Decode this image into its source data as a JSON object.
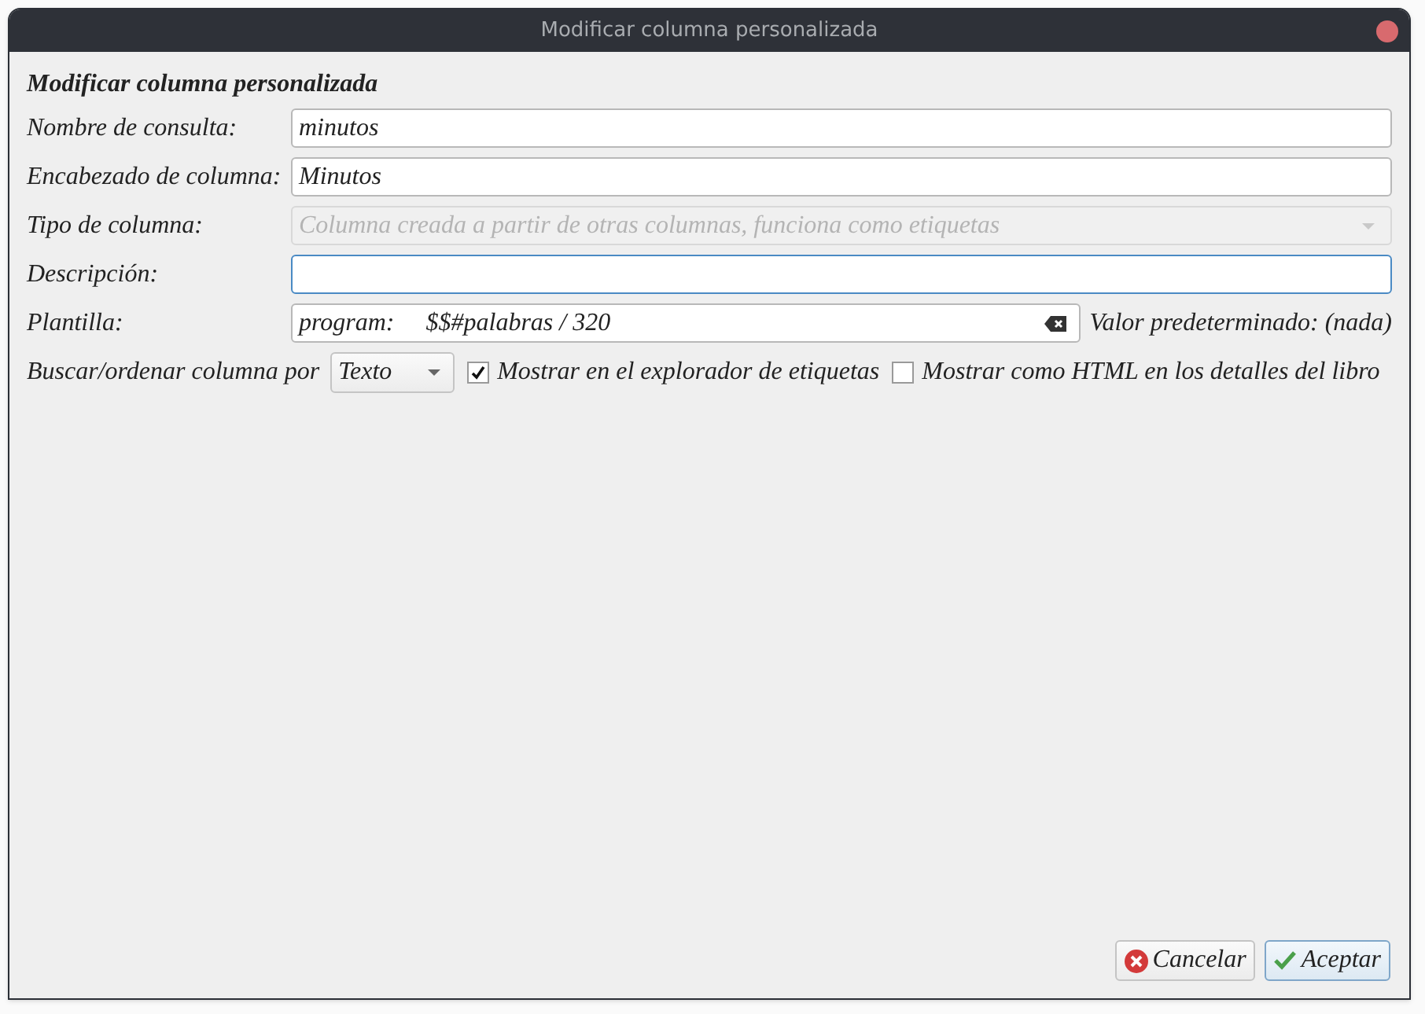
{
  "window": {
    "title": "Modificar columna personalizada"
  },
  "heading": "Modificar columna personalizada",
  "fields": [
    {
      "kind": "text",
      "label": "Nombre de consulta:",
      "value": "minutos",
      "focused": false
    },
    {
      "kind": "text",
      "label": "Encabezado de columna:",
      "value": "Minutos",
      "focused": false
    },
    {
      "kind": "combo",
      "label": "Tipo de columna:",
      "value": "Columna creada a partir de otras columnas, funciona como etiquetas",
      "disabled": true
    },
    {
      "kind": "text",
      "label": "Descripción:",
      "focused": true
    },
    {
      "kind": "template",
      "label": "Plantilla:",
      "value": "program:     $$#palabras / 320",
      "note": "Valor predeterminado: (nada)"
    }
  ],
  "sort_row": {
    "label": "Buscar/ordenar columna por",
    "select": "Texto",
    "checkboxes": [
      {
        "label": "Mostrar en el explorador de etiquetas",
        "checked": true
      },
      {
        "label": "Mostrar como HTML en los detalles del libro",
        "checked": false
      }
    ]
  },
  "buttons": [
    {
      "kind": "cancel",
      "label": "Cancelar",
      "selected": false
    },
    {
      "kind": "ok",
      "label": "Aceptar",
      "selected": true
    }
  ]
}
